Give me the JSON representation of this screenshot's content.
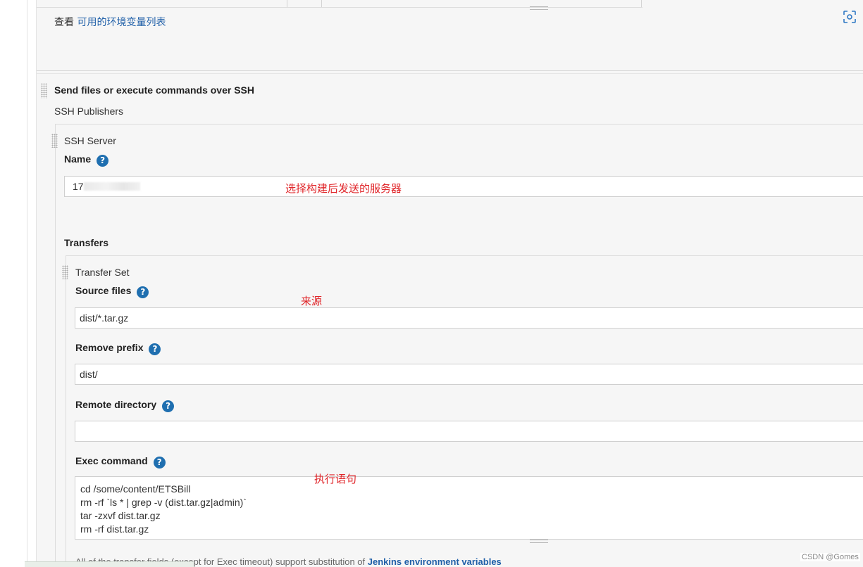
{
  "env_vars": {
    "prefix": "查看",
    "link": "可用的环境变量列表"
  },
  "section": {
    "title": "Send files or execute commands over SSH",
    "publishers_label": "SSH Publishers"
  },
  "ssh_server": {
    "heading": "SSH Server",
    "name_label": "Name",
    "name_value_visible": "17",
    "name_note": "选择构建后发送的服务器"
  },
  "transfers": {
    "label": "Transfers",
    "set_heading": "Transfer Set",
    "source_files_label": "Source files",
    "source_files_value": "dist/*.tar.gz",
    "source_note": "来源",
    "remove_prefix_label": "Remove prefix",
    "remove_prefix_value": "dist/",
    "remote_directory_label": "Remote directory",
    "remote_directory_value": "",
    "exec_command_label": "Exec command",
    "exec_note": "执行语句",
    "exec_lines": [
      "cd /some/content/ETSBill",
      "rm -rf `ls * | grep -v (dist.tar.gz|admin)`",
      "tar -zxvf dist.tar.gz",
      "rm -rf dist.tar.gz"
    ]
  },
  "footer": {
    "text": "All of the transfer fields (except for Exec timeout) support substitution of ",
    "link": "Jenkins environment variables"
  },
  "watermark": "CSDN @Gomes",
  "help_glyph": "?",
  "icons": {
    "help": "question-circle-icon",
    "drag": "drag-handle-icon",
    "scan": "scan-icon"
  },
  "colors": {
    "link": "#1f5fa8",
    "help": "#1f6fb0",
    "annotation": "#e0262a"
  }
}
